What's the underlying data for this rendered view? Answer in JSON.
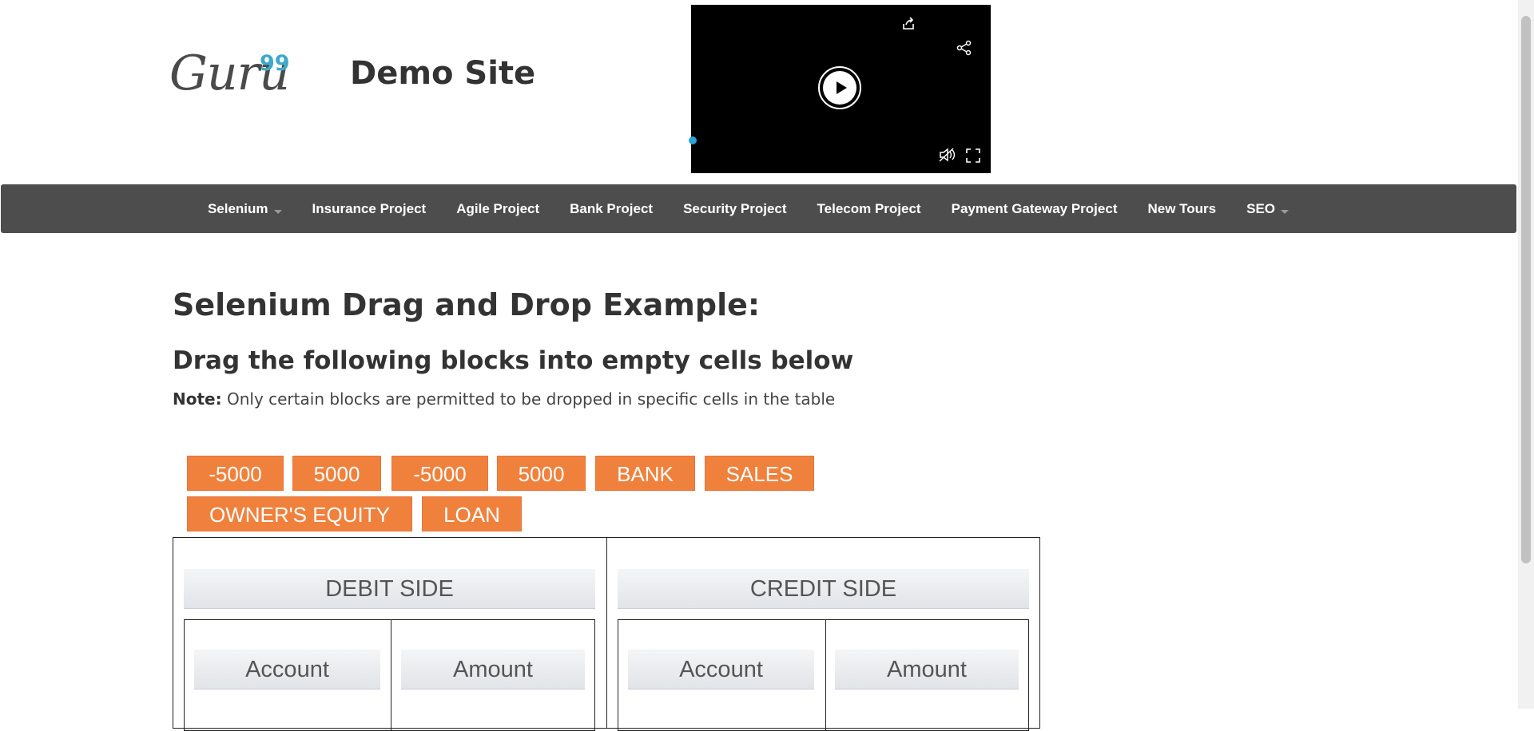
{
  "header": {
    "logo_text": "Guru",
    "logo_sup": "99",
    "site_title": "Demo Site"
  },
  "video": {
    "icons": [
      "share-arrow-icon",
      "share-icon",
      "play-icon",
      "mute-icon",
      "fullscreen-icon"
    ]
  },
  "nav": {
    "items": [
      {
        "label": "Selenium",
        "dropdown": true
      },
      {
        "label": "Insurance Project",
        "dropdown": false
      },
      {
        "label": "Agile Project",
        "dropdown": false
      },
      {
        "label": "Bank Project",
        "dropdown": false
      },
      {
        "label": "Security Project",
        "dropdown": false
      },
      {
        "label": "Telecom Project",
        "dropdown": false
      },
      {
        "label": "Payment Gateway Project",
        "dropdown": false
      },
      {
        "label": "New Tours",
        "dropdown": false
      },
      {
        "label": "SEO",
        "dropdown": true
      }
    ]
  },
  "main": {
    "title": "Selenium Drag and Drop Example:",
    "subtitle": "Drag the following blocks into empty cells below",
    "note_label": "Note:",
    "note_text": " Only certain blocks are permitted to be dropped in specific cells in the table"
  },
  "blocks": [
    "-5000",
    "5000",
    "-5000",
    "5000",
    "BANK",
    "SALES",
    "OWNER'S EQUITY",
    "LOAN"
  ],
  "table": {
    "debit_header": "DEBIT SIDE",
    "credit_header": "CREDIT SIDE",
    "debit_account": "Account",
    "debit_amount": "Amount",
    "credit_account": "Account",
    "credit_amount": "Amount"
  },
  "colors": {
    "block_bg": "#f0813d",
    "nav_bg": "#4d4d4d",
    "logo_sup": "#3fa9c8"
  }
}
